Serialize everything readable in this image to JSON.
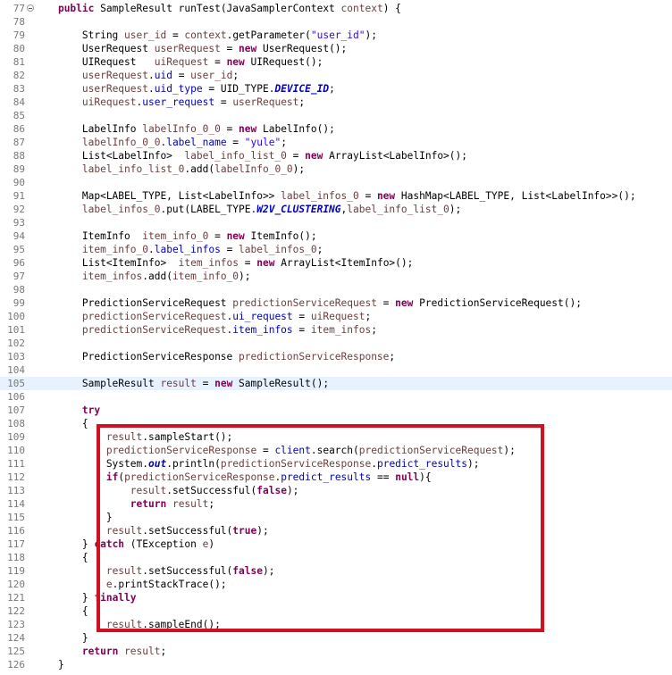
{
  "editor": {
    "fold_line": 0,
    "current_line": 28,
    "lines": [
      {
        "num": "77",
        "tokens": [
          {
            "t": "    ",
            "k": "plain"
          },
          {
            "t": "public",
            "k": "kw"
          },
          {
            "t": " SampleResult runTest(JavaSamplerContext ",
            "k": "plain"
          },
          {
            "t": "context",
            "k": "var"
          },
          {
            "t": ") {",
            "k": "plain"
          }
        ]
      },
      {
        "num": "78",
        "tokens": []
      },
      {
        "num": "79",
        "tokens": [
          {
            "t": "        String ",
            "k": "plain"
          },
          {
            "t": "user_id",
            "k": "var"
          },
          {
            "t": " = ",
            "k": "plain"
          },
          {
            "t": "context",
            "k": "var"
          },
          {
            "t": ".getParameter(",
            "k": "plain"
          },
          {
            "t": "\"user_id\"",
            "k": "str"
          },
          {
            "t": ");",
            "k": "plain"
          }
        ]
      },
      {
        "num": "80",
        "tokens": [
          {
            "t": "        UserRequest ",
            "k": "plain"
          },
          {
            "t": "userRequest",
            "k": "var"
          },
          {
            "t": " = ",
            "k": "plain"
          },
          {
            "t": "new",
            "k": "kw"
          },
          {
            "t": " UserRequest();",
            "k": "plain"
          }
        ]
      },
      {
        "num": "81",
        "tokens": [
          {
            "t": "        UIRequest   ",
            "k": "plain"
          },
          {
            "t": "uiRequest",
            "k": "var"
          },
          {
            "t": " = ",
            "k": "plain"
          },
          {
            "t": "new",
            "k": "kw"
          },
          {
            "t": " UIRequest();",
            "k": "plain"
          }
        ]
      },
      {
        "num": "82",
        "tokens": [
          {
            "t": "        ",
            "k": "plain"
          },
          {
            "t": "userRequest",
            "k": "var"
          },
          {
            "t": ".",
            "k": "plain"
          },
          {
            "t": "uid",
            "k": "field"
          },
          {
            "t": " = ",
            "k": "plain"
          },
          {
            "t": "user_id",
            "k": "var"
          },
          {
            "t": ";",
            "k": "plain"
          }
        ]
      },
      {
        "num": "83",
        "tokens": [
          {
            "t": "        ",
            "k": "plain"
          },
          {
            "t": "userRequest",
            "k": "var"
          },
          {
            "t": ".",
            "k": "plain"
          },
          {
            "t": "uid_type",
            "k": "field"
          },
          {
            "t": " = UID_TYPE.",
            "k": "plain"
          },
          {
            "t": "DEVICE_ID",
            "k": "sfield"
          },
          {
            "t": ";",
            "k": "plain"
          }
        ]
      },
      {
        "num": "84",
        "tokens": [
          {
            "t": "        ",
            "k": "plain"
          },
          {
            "t": "uiRequest",
            "k": "var"
          },
          {
            "t": ".",
            "k": "plain"
          },
          {
            "t": "user_request",
            "k": "field"
          },
          {
            "t": " = ",
            "k": "plain"
          },
          {
            "t": "userRequest",
            "k": "var"
          },
          {
            "t": ";",
            "k": "plain"
          }
        ]
      },
      {
        "num": "85",
        "tokens": []
      },
      {
        "num": "86",
        "tokens": [
          {
            "t": "        LabelInfo ",
            "k": "plain"
          },
          {
            "t": "labelInfo_0_0",
            "k": "var"
          },
          {
            "t": " = ",
            "k": "plain"
          },
          {
            "t": "new",
            "k": "kw"
          },
          {
            "t": " LabelInfo();",
            "k": "plain"
          }
        ]
      },
      {
        "num": "87",
        "tokens": [
          {
            "t": "        ",
            "k": "plain"
          },
          {
            "t": "labelInfo_0_0",
            "k": "var"
          },
          {
            "t": ".",
            "k": "plain"
          },
          {
            "t": "label_name",
            "k": "field"
          },
          {
            "t": " = ",
            "k": "plain"
          },
          {
            "t": "\"yule\"",
            "k": "str"
          },
          {
            "t": ";",
            "k": "plain"
          }
        ]
      },
      {
        "num": "88",
        "tokens": [
          {
            "t": "        List<LabelInfo>  ",
            "k": "plain"
          },
          {
            "t": "label_info_list_0",
            "k": "var"
          },
          {
            "t": " = ",
            "k": "plain"
          },
          {
            "t": "new",
            "k": "kw"
          },
          {
            "t": " ArrayList<LabelInfo>();",
            "k": "plain"
          }
        ]
      },
      {
        "num": "89",
        "tokens": [
          {
            "t": "        ",
            "k": "plain"
          },
          {
            "t": "label_info_list_0",
            "k": "var"
          },
          {
            "t": ".add(",
            "k": "plain"
          },
          {
            "t": "labelInfo_0_0",
            "k": "var"
          },
          {
            "t": ");",
            "k": "plain"
          }
        ]
      },
      {
        "num": "90",
        "tokens": []
      },
      {
        "num": "91",
        "tokens": [
          {
            "t": "        Map<LABEL_TYPE, List<LabelInfo>> ",
            "k": "plain"
          },
          {
            "t": "label_infos_0",
            "k": "var"
          },
          {
            "t": " = ",
            "k": "plain"
          },
          {
            "t": "new",
            "k": "kw"
          },
          {
            "t": " HashMap<LABEL_TYPE, List<LabelInfo>>();",
            "k": "plain"
          }
        ]
      },
      {
        "num": "92",
        "tokens": [
          {
            "t": "        ",
            "k": "plain"
          },
          {
            "t": "label_infos_0",
            "k": "var"
          },
          {
            "t": ".put(LABEL_TYPE.",
            "k": "plain"
          },
          {
            "t": "W2V_CLUSTERING",
            "k": "sfield"
          },
          {
            "t": ",",
            "k": "plain"
          },
          {
            "t": "label_info_list_0",
            "k": "var"
          },
          {
            "t": ");",
            "k": "plain"
          }
        ]
      },
      {
        "num": "93",
        "tokens": []
      },
      {
        "num": "94",
        "tokens": [
          {
            "t": "        ItemInfo  ",
            "k": "plain"
          },
          {
            "t": "item_info_0",
            "k": "var"
          },
          {
            "t": " = ",
            "k": "plain"
          },
          {
            "t": "new",
            "k": "kw"
          },
          {
            "t": " ItemInfo();",
            "k": "plain"
          }
        ]
      },
      {
        "num": "95",
        "tokens": [
          {
            "t": "        ",
            "k": "plain"
          },
          {
            "t": "item_info_0",
            "k": "var"
          },
          {
            "t": ".",
            "k": "plain"
          },
          {
            "t": "label_infos",
            "k": "field"
          },
          {
            "t": " = ",
            "k": "plain"
          },
          {
            "t": "label_infos_0",
            "k": "var"
          },
          {
            "t": ";",
            "k": "plain"
          }
        ]
      },
      {
        "num": "96",
        "tokens": [
          {
            "t": "        List<ItemInfo>  ",
            "k": "plain"
          },
          {
            "t": "item_infos",
            "k": "var"
          },
          {
            "t": " = ",
            "k": "plain"
          },
          {
            "t": "new",
            "k": "kw"
          },
          {
            "t": " ArrayList<ItemInfo>();",
            "k": "plain"
          }
        ]
      },
      {
        "num": "97",
        "tokens": [
          {
            "t": "        ",
            "k": "plain"
          },
          {
            "t": "item_infos",
            "k": "var"
          },
          {
            "t": ".add(",
            "k": "plain"
          },
          {
            "t": "item_info_0",
            "k": "var"
          },
          {
            "t": ");",
            "k": "plain"
          }
        ]
      },
      {
        "num": "98",
        "tokens": []
      },
      {
        "num": "99",
        "tokens": [
          {
            "t": "        PredictionServiceRequest ",
            "k": "plain"
          },
          {
            "t": "predictionServiceRequest",
            "k": "var"
          },
          {
            "t": " = ",
            "k": "plain"
          },
          {
            "t": "new",
            "k": "kw"
          },
          {
            "t": " PredictionServiceRequest();",
            "k": "plain"
          }
        ]
      },
      {
        "num": "100",
        "tokens": [
          {
            "t": "        ",
            "k": "plain"
          },
          {
            "t": "predictionServiceRequest",
            "k": "var"
          },
          {
            "t": ".",
            "k": "plain"
          },
          {
            "t": "ui_request",
            "k": "field"
          },
          {
            "t": " = ",
            "k": "plain"
          },
          {
            "t": "uiRequest",
            "k": "var"
          },
          {
            "t": ";",
            "k": "plain"
          }
        ]
      },
      {
        "num": "101",
        "tokens": [
          {
            "t": "        ",
            "k": "plain"
          },
          {
            "t": "predictionServiceRequest",
            "k": "var"
          },
          {
            "t": ".",
            "k": "plain"
          },
          {
            "t": "item_infos",
            "k": "field"
          },
          {
            "t": " = ",
            "k": "plain"
          },
          {
            "t": "item_infos",
            "k": "var"
          },
          {
            "t": ";",
            "k": "plain"
          }
        ]
      },
      {
        "num": "102",
        "tokens": []
      },
      {
        "num": "103",
        "tokens": [
          {
            "t": "        PredictionServiceResponse ",
            "k": "plain"
          },
          {
            "t": "predictionServiceResponse",
            "k": "var"
          },
          {
            "t": ";",
            "k": "plain"
          }
        ]
      },
      {
        "num": "104",
        "tokens": []
      },
      {
        "num": "105",
        "tokens": [
          {
            "t": "        SampleResult ",
            "k": "plain"
          },
          {
            "t": "result",
            "k": "var"
          },
          {
            "t": " = ",
            "k": "plain"
          },
          {
            "t": "new",
            "k": "kw"
          },
          {
            "t": " SampleResult();",
            "k": "plain"
          }
        ]
      },
      {
        "num": "106",
        "tokens": []
      },
      {
        "num": "107",
        "tokens": [
          {
            "t": "        ",
            "k": "plain"
          },
          {
            "t": "try",
            "k": "kw"
          }
        ]
      },
      {
        "num": "108",
        "tokens": [
          {
            "t": "        {",
            "k": "plain"
          }
        ]
      },
      {
        "num": "109",
        "tokens": [
          {
            "t": "            ",
            "k": "plain"
          },
          {
            "t": "result",
            "k": "var"
          },
          {
            "t": ".sampleStart();",
            "k": "plain"
          }
        ]
      },
      {
        "num": "110",
        "tokens": [
          {
            "t": "            ",
            "k": "plain"
          },
          {
            "t": "predictionServiceResponse",
            "k": "var"
          },
          {
            "t": " = ",
            "k": "plain"
          },
          {
            "t": "client",
            "k": "field"
          },
          {
            "t": ".search(",
            "k": "plain"
          },
          {
            "t": "predictionServiceRequest",
            "k": "var"
          },
          {
            "t": ");",
            "k": "plain"
          }
        ]
      },
      {
        "num": "111",
        "tokens": [
          {
            "t": "            System.",
            "k": "plain"
          },
          {
            "t": "out",
            "k": "sfield"
          },
          {
            "t": ".println(",
            "k": "plain"
          },
          {
            "t": "predictionServiceResponse",
            "k": "var"
          },
          {
            "t": ".",
            "k": "plain"
          },
          {
            "t": "predict_results",
            "k": "field"
          },
          {
            "t": ");",
            "k": "plain"
          }
        ]
      },
      {
        "num": "112",
        "tokens": [
          {
            "t": "            ",
            "k": "plain"
          },
          {
            "t": "if",
            "k": "kw"
          },
          {
            "t": "(",
            "k": "plain"
          },
          {
            "t": "predictionServiceResponse",
            "k": "var"
          },
          {
            "t": ".",
            "k": "plain"
          },
          {
            "t": "predict_results",
            "k": "field"
          },
          {
            "t": " == ",
            "k": "plain"
          },
          {
            "t": "null",
            "k": "kw"
          },
          {
            "t": "){",
            "k": "plain"
          }
        ]
      },
      {
        "num": "113",
        "tokens": [
          {
            "t": "                ",
            "k": "plain"
          },
          {
            "t": "result",
            "k": "var"
          },
          {
            "t": ".setSuccessful(",
            "k": "plain"
          },
          {
            "t": "false",
            "k": "kw"
          },
          {
            "t": ");",
            "k": "plain"
          }
        ]
      },
      {
        "num": "114",
        "tokens": [
          {
            "t": "                ",
            "k": "plain"
          },
          {
            "t": "return",
            "k": "kw"
          },
          {
            "t": " ",
            "k": "plain"
          },
          {
            "t": "result",
            "k": "var"
          },
          {
            "t": ";",
            "k": "plain"
          }
        ]
      },
      {
        "num": "115",
        "tokens": [
          {
            "t": "            }",
            "k": "plain"
          }
        ]
      },
      {
        "num": "116",
        "tokens": [
          {
            "t": "            ",
            "k": "plain"
          },
          {
            "t": "result",
            "k": "var"
          },
          {
            "t": ".setSuccessful(",
            "k": "plain"
          },
          {
            "t": "true",
            "k": "kw"
          },
          {
            "t": ");",
            "k": "plain"
          }
        ]
      },
      {
        "num": "117",
        "tokens": [
          {
            "t": "        } ",
            "k": "plain"
          },
          {
            "t": "catch",
            "k": "kw"
          },
          {
            "t": " (TException ",
            "k": "plain"
          },
          {
            "t": "e",
            "k": "var"
          },
          {
            "t": ")",
            "k": "plain"
          }
        ]
      },
      {
        "num": "118",
        "tokens": [
          {
            "t": "        {",
            "k": "plain"
          }
        ]
      },
      {
        "num": "119",
        "tokens": [
          {
            "t": "            ",
            "k": "plain"
          },
          {
            "t": "result",
            "k": "var"
          },
          {
            "t": ".setSuccessful(",
            "k": "plain"
          },
          {
            "t": "false",
            "k": "kw"
          },
          {
            "t": ");",
            "k": "plain"
          }
        ]
      },
      {
        "num": "120",
        "tokens": [
          {
            "t": "            ",
            "k": "plain"
          },
          {
            "t": "e",
            "k": "var"
          },
          {
            "t": ".printStackTrace();",
            "k": "plain"
          }
        ]
      },
      {
        "num": "121",
        "tokens": [
          {
            "t": "        } ",
            "k": "plain"
          },
          {
            "t": "finally",
            "k": "kw"
          }
        ]
      },
      {
        "num": "122",
        "tokens": [
          {
            "t": "        {",
            "k": "plain"
          }
        ]
      },
      {
        "num": "123",
        "tokens": [
          {
            "t": "            ",
            "k": "plain"
          },
          {
            "t": "result",
            "k": "var"
          },
          {
            "t": ".sampleEnd();",
            "k": "plain"
          }
        ]
      },
      {
        "num": "124",
        "tokens": [
          {
            "t": "        }",
            "k": "plain"
          }
        ]
      },
      {
        "num": "125",
        "tokens": [
          {
            "t": "        ",
            "k": "plain"
          },
          {
            "t": "return",
            "k": "kw"
          },
          {
            "t": " ",
            "k": "plain"
          },
          {
            "t": "result",
            "k": "var"
          },
          {
            "t": ";",
            "k": "plain"
          }
        ]
      },
      {
        "num": "126",
        "tokens": [
          {
            "t": "    }",
            "k": "plain"
          }
        ]
      }
    ]
  },
  "annotation": {
    "label": "highlight-box",
    "color": "#d2101e"
  },
  "colors": {
    "keyword": "#7f0055",
    "local_variable": "#6a3e3e",
    "field": "#0000c0",
    "string": "#2a00ff",
    "line_number": "#787878",
    "current_line_bg": "#e8f2fe"
  }
}
